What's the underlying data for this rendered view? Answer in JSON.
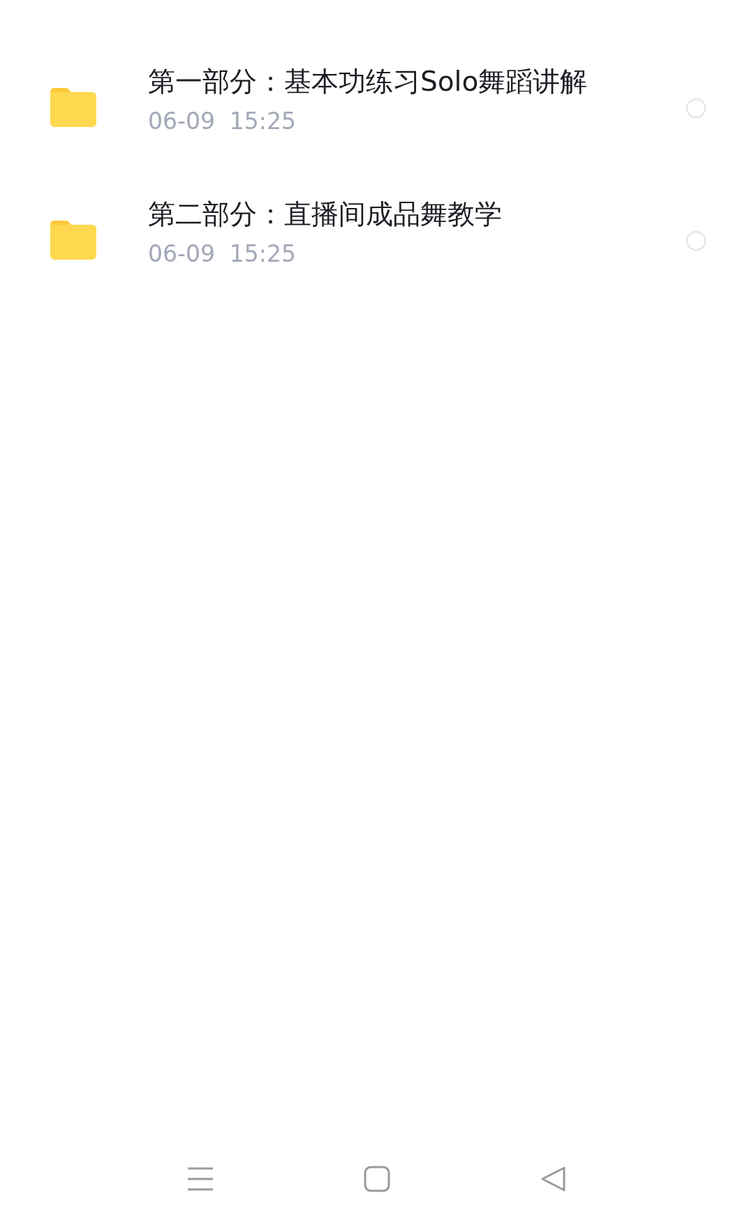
{
  "files": [
    {
      "name": "第一部分：基本功练习Solo舞蹈讲解",
      "date": "06-09",
      "time": "15:25",
      "selected": false
    },
    {
      "name": "第二部分：直播间成品舞教学",
      "date": "06-09",
      "time": "15:25",
      "selected": false
    }
  ]
}
